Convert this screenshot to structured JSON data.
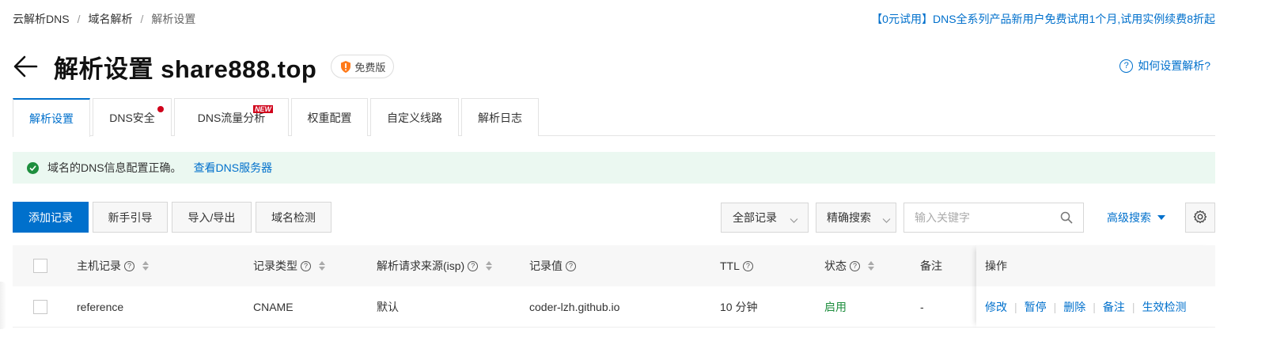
{
  "breadcrumb": {
    "items": [
      "云解析DNS",
      "域名解析",
      "解析设置"
    ],
    "separator": "/"
  },
  "promo": "【0元试用】DNS全系列产品新用户免费试用1个月,试用实例续费8折起",
  "header": {
    "title": "解析设置 share888.top",
    "badge": "免费版",
    "help": "如何设置解析?"
  },
  "tabs": [
    {
      "label": "解析设置",
      "active": true
    },
    {
      "label": "DNS安全",
      "dot": true
    },
    {
      "label": "DNS流量分析",
      "tag": "NEW"
    },
    {
      "label": "权重配置"
    },
    {
      "label": "自定义线路"
    },
    {
      "label": "解析日志"
    }
  ],
  "alert": {
    "message": "域名的DNS信息配置正确。",
    "link": "查看DNS服务器"
  },
  "toolbar": {
    "add": "添加记录",
    "guide": "新手引导",
    "import_export": "导入/导出",
    "check": "域名检测",
    "record_filter": "全部记录",
    "search_mode": "精确搜索",
    "search_placeholder": "输入关键字",
    "advanced": "高级搜索"
  },
  "table": {
    "headers": {
      "host": "主机记录",
      "type": "记录类型",
      "isp": "解析请求来源(isp)",
      "value": "记录值",
      "ttl": "TTL",
      "status": "状态",
      "remark": "备注",
      "ops": "操作"
    },
    "rows": [
      {
        "host": "reference",
        "type": "CNAME",
        "isp": "默认",
        "value": "coder-lzh.github.io",
        "ttl": "10 分钟",
        "status": "启用",
        "remark": "-"
      }
    ],
    "actions": [
      "修改",
      "暂停",
      "删除",
      "备注",
      "生效检测"
    ]
  },
  "colors": {
    "accent": "#0070cc",
    "success": "#1e8e3e",
    "danger": "#d0021b"
  }
}
